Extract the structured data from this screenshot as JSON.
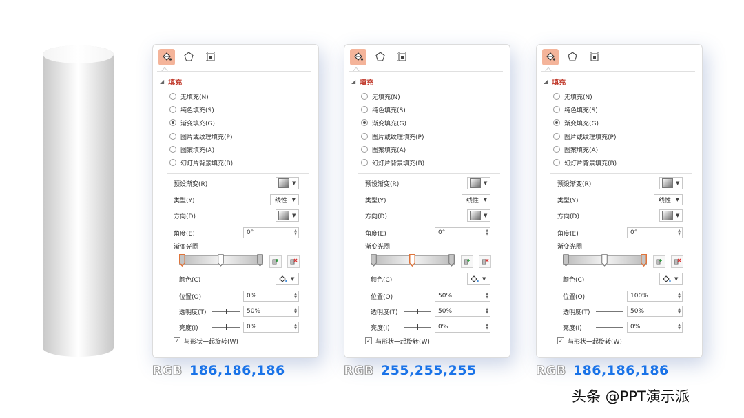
{
  "tabs": [
    {
      "icon": "fill-bucket-icon",
      "active": true
    },
    {
      "icon": "pentagon-shape-icon",
      "active": false
    },
    {
      "icon": "size-properties-icon",
      "active": false
    }
  ],
  "panels": [
    {
      "section_title": "填充",
      "fill_options": [
        "无填充(N)",
        "纯色填充(S)",
        "渐变填充(G)",
        "图片或纹理填充(P)",
        "图案填充(A)",
        "幻灯片背景填充(B)"
      ],
      "selected_fill": 2,
      "preset_label": "预设渐变(R)",
      "type_label": "类型(Y)",
      "type_value": "线性",
      "direction_label": "方向(D)",
      "angle_label": "角度(E)",
      "angle_value": "0°",
      "stops_label": "渐变光圈",
      "selected_stop": 0,
      "color_label": "颜色(C)",
      "position_label": "位置(O)",
      "position_value": "0%",
      "transparency_label": "透明度(T)",
      "transparency_value": "50%",
      "brightness_label": "亮度(I)",
      "brightness_value": "0%",
      "rotate_label": "与形状一起旋转(W)",
      "rotate_checked": true,
      "caption_key": "RGB",
      "caption_value": "186,186,186"
    },
    {
      "section_title": "填充",
      "fill_options": [
        "无填充(N)",
        "纯色填充(S)",
        "渐变填充(G)",
        "图片或纹理填充(P)",
        "图案填充(A)",
        "幻灯片背景填充(B)"
      ],
      "selected_fill": 2,
      "preset_label": "预设渐变(R)",
      "type_label": "类型(Y)",
      "type_value": "线性",
      "direction_label": "方向(D)",
      "angle_label": "角度(E)",
      "angle_value": "0°",
      "stops_label": "渐变光圈",
      "selected_stop": 1,
      "color_label": "颜色(C)",
      "position_label": "位置(O)",
      "position_value": "50%",
      "transparency_label": "透明度(T)",
      "transparency_value": "50%",
      "brightness_label": "亮度(I)",
      "brightness_value": "0%",
      "rotate_label": "与形状一起旋转(W)",
      "rotate_checked": true,
      "caption_key": "RGB",
      "caption_value": "255,255,255"
    },
    {
      "section_title": "填充",
      "fill_options": [
        "无填充(N)",
        "纯色填充(S)",
        "渐变填充(G)",
        "图片或纹理填充(P)",
        "图案填充(A)",
        "幻灯片背景填充(B)"
      ],
      "selected_fill": 2,
      "preset_label": "预设渐变(R)",
      "type_label": "类型(Y)",
      "type_value": "线性",
      "direction_label": "方向(D)",
      "angle_label": "角度(E)",
      "angle_value": "0°",
      "stops_label": "渐变光圈",
      "selected_stop": 2,
      "color_label": "颜色(C)",
      "position_label": "位置(O)",
      "position_value": "100%",
      "transparency_label": "透明度(T)",
      "transparency_value": "50%",
      "brightness_label": "亮度(I)",
      "brightness_value": "0%",
      "rotate_label": "与形状一起旋转(W)",
      "rotate_checked": true,
      "caption_key": "RGB",
      "caption_value": "186,186,186"
    }
  ],
  "colors": {
    "accent": "#f4b49a",
    "section_title": "#c0392b",
    "selected_stop": "#e0743a",
    "caption_value": "#1a73e8"
  },
  "watermark": "头条 @PPT演示派"
}
